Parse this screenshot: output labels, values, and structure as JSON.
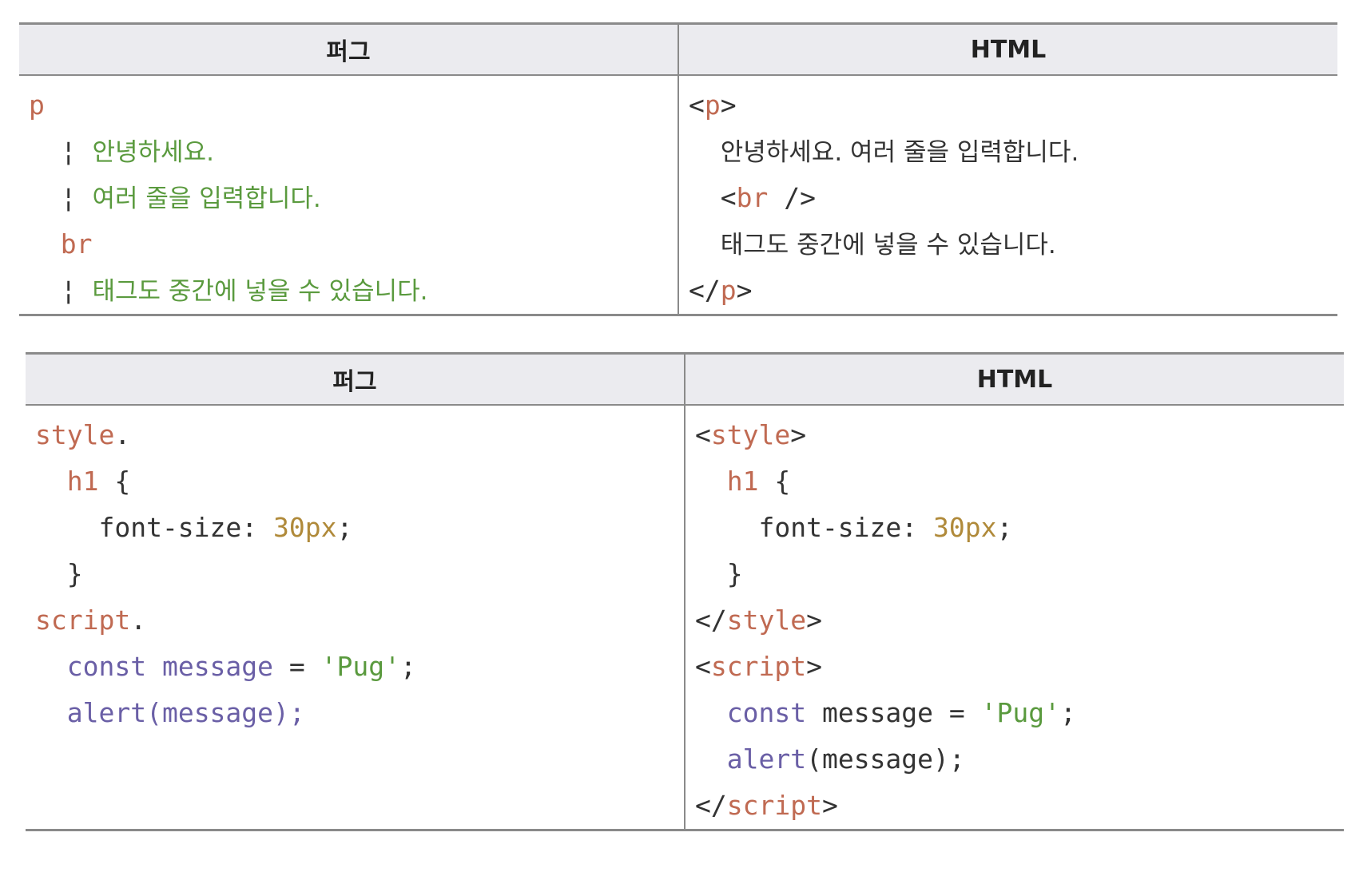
{
  "tables": [
    {
      "headers": [
        "퍼그",
        "HTML"
      ],
      "pug": [
        [
          {
            "t": "p",
            "c": "tag"
          }
        ],
        [
          {
            "t": "  ",
            "c": "plain"
          },
          {
            "t": "¦ ",
            "c": "bar"
          },
          {
            "t": "안녕하세요.",
            "c": "txt"
          }
        ],
        [
          {
            "t": "  ",
            "c": "plain"
          },
          {
            "t": "¦ ",
            "c": "bar"
          },
          {
            "t": "여러 줄을 입력합니다.",
            "c": "txt"
          }
        ],
        [
          {
            "t": "  ",
            "c": "plain"
          },
          {
            "t": "br",
            "c": "tag"
          }
        ],
        [
          {
            "t": "  ",
            "c": "plain"
          },
          {
            "t": "¦ ",
            "c": "bar"
          },
          {
            "t": "태그도 중간에 넣을 수 있습니다.",
            "c": "txt"
          }
        ]
      ],
      "html": [
        [
          {
            "t": "<",
            "c": "plain"
          },
          {
            "t": "p",
            "c": "tag"
          },
          {
            "t": ">",
            "c": "plain"
          }
        ],
        [
          {
            "t": "  ",
            "c": "plain"
          },
          {
            "t": "안녕하세요. 여러 줄을 입력합니다.",
            "c": "kor"
          }
        ],
        [
          {
            "t": "  <",
            "c": "plain"
          },
          {
            "t": "br",
            "c": "tag"
          },
          {
            "t": " />",
            "c": "plain"
          }
        ],
        [
          {
            "t": "  ",
            "c": "plain"
          },
          {
            "t": "태그도 중간에 넣을 수 있습니다.",
            "c": "kor"
          }
        ],
        [
          {
            "t": "</",
            "c": "plain"
          },
          {
            "t": "p",
            "c": "tag"
          },
          {
            "t": ">",
            "c": "plain"
          }
        ]
      ]
    },
    {
      "headers": [
        "퍼그",
        "HTML"
      ],
      "pug": [
        [
          {
            "t": "style",
            "c": "tag"
          },
          {
            "t": ".",
            "c": "plain"
          }
        ],
        [
          {
            "t": "  ",
            "c": "plain"
          },
          {
            "t": "h1",
            "c": "tag"
          },
          {
            "t": " {",
            "c": "plain"
          }
        ],
        [
          {
            "t": "    font-size: ",
            "c": "plain"
          },
          {
            "t": "30px",
            "c": "num"
          },
          {
            "t": ";",
            "c": "plain"
          }
        ],
        [
          {
            "t": "  }",
            "c": "plain"
          }
        ],
        [
          {
            "t": "script",
            "c": "tag"
          },
          {
            "t": ".",
            "c": "plain"
          }
        ],
        [
          {
            "t": "  ",
            "c": "plain"
          },
          {
            "t": "const message",
            "c": "kw"
          },
          {
            "t": " = ",
            "c": "plain"
          },
          {
            "t": "'Pug'",
            "c": "str"
          },
          {
            "t": ";",
            "c": "plain"
          }
        ],
        [
          {
            "t": "  ",
            "c": "plain"
          },
          {
            "t": "alert(message);",
            "c": "kw"
          }
        ]
      ],
      "html": [
        [
          {
            "t": "<",
            "c": "plain"
          },
          {
            "t": "style",
            "c": "tag"
          },
          {
            "t": ">",
            "c": "plain"
          }
        ],
        [
          {
            "t": "  ",
            "c": "plain"
          },
          {
            "t": "h1",
            "c": "tag"
          },
          {
            "t": " {",
            "c": "plain"
          }
        ],
        [
          {
            "t": "    font-size: ",
            "c": "plain"
          },
          {
            "t": "30px",
            "c": "num"
          },
          {
            "t": ";",
            "c": "plain"
          }
        ],
        [
          {
            "t": "  }",
            "c": "plain"
          }
        ],
        [
          {
            "t": "</",
            "c": "plain"
          },
          {
            "t": "style",
            "c": "tag"
          },
          {
            "t": ">",
            "c": "plain"
          }
        ],
        [
          {
            "t": "<",
            "c": "plain"
          },
          {
            "t": "script",
            "c": "tag"
          },
          {
            "t": ">",
            "c": "plain"
          }
        ],
        [
          {
            "t": "  ",
            "c": "plain"
          },
          {
            "t": "const",
            "c": "kw"
          },
          {
            "t": " message = ",
            "c": "plain"
          },
          {
            "t": "'Pug'",
            "c": "str"
          },
          {
            "t": ";",
            "c": "plain"
          }
        ],
        [
          {
            "t": "  ",
            "c": "plain"
          },
          {
            "t": "alert",
            "c": "kw"
          },
          {
            "t": "(message);",
            "c": "plain"
          }
        ],
        [
          {
            "t": "</",
            "c": "plain"
          },
          {
            "t": "script",
            "c": "tag"
          },
          {
            "t": ">",
            "c": "plain"
          }
        ]
      ]
    }
  ]
}
